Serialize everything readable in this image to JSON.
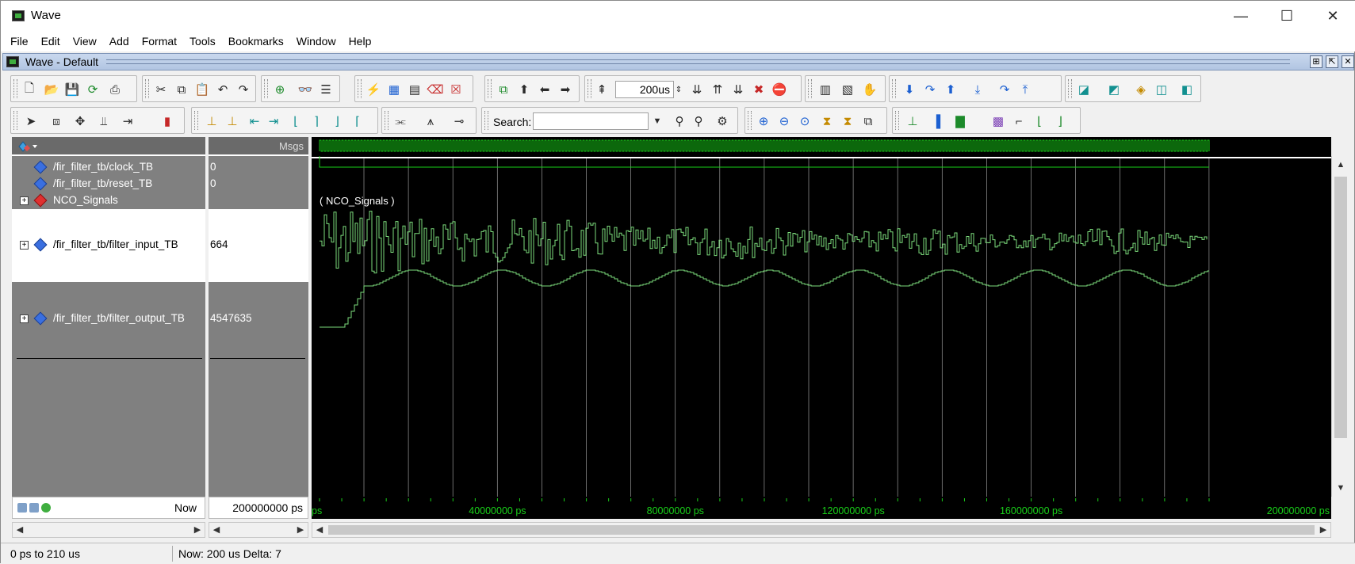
{
  "window": {
    "title": "Wave",
    "minimize": "—",
    "maximize": "☐",
    "close": "✕"
  },
  "menu": [
    "File",
    "Edit",
    "View",
    "Add",
    "Format",
    "Tools",
    "Bookmarks",
    "Window",
    "Help"
  ],
  "pane": {
    "title": "Wave - Default"
  },
  "toolbar1": {
    "run_length": "200us"
  },
  "toolbar2": {
    "search_label": "Search:",
    "search_value": ""
  },
  "columns": {
    "msgs": "Msgs"
  },
  "signals": [
    {
      "name": "/fir_filter_tb/clock_TB",
      "value": "0",
      "type": "blue",
      "expandable": false
    },
    {
      "name": "/fir_filter_tb/reset_TB",
      "value": "0",
      "type": "blue",
      "expandable": false
    },
    {
      "name": "NCO_Signals",
      "value": "",
      "type": "red",
      "expandable": true
    },
    {
      "name": "/fir_filter_tb/filter_input_TB",
      "value": "664",
      "type": "blue",
      "expandable": true
    },
    {
      "name": "/fir_filter_tb/filter_output_TB",
      "value": "4547635",
      "type": "blue",
      "expandable": true
    }
  ],
  "wave": {
    "group_label": "( NCO_Signals )",
    "trace_color": "#7cdc7c",
    "clock_color": "#19d019",
    "gridline_color": "#9a9a9a"
  },
  "now": {
    "label": "Now",
    "value": "200000000 ps"
  },
  "timeline": {
    "ticks": [
      "ps",
      "40000000 ps",
      "80000000 ps",
      "120000000 ps",
      "160000000 ps",
      "200000000 ps"
    ],
    "range_ps": [
      0,
      200000000
    ]
  },
  "status": {
    "range": "0 ps to 210 us",
    "now_delta": "Now: 200 us  Delta: 7"
  }
}
